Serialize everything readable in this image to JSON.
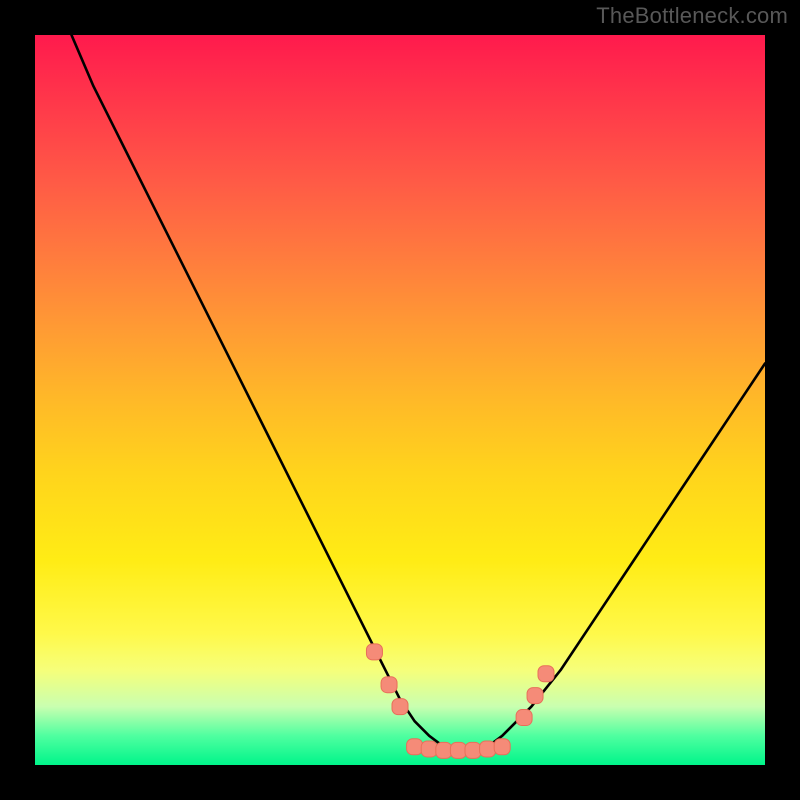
{
  "watermark": "TheBottleneck.com",
  "colors": {
    "frame": "#000000",
    "curve": "#000000",
    "marker_fill": "#f58b78",
    "marker_stroke": "#e86f5a"
  },
  "chart_data": {
    "type": "line",
    "title": "",
    "xlabel": "",
    "ylabel": "",
    "xlim": [
      0,
      100
    ],
    "ylim": [
      0,
      100
    ],
    "legend": false,
    "grid": false,
    "series": [
      {
        "name": "bottleneck-curve",
        "x": [
          5,
          8,
          12,
          16,
          20,
          24,
          28,
          32,
          36,
          40,
          44,
          48,
          50,
          52,
          54,
          56,
          58,
          60,
          62,
          64,
          68,
          72,
          76,
          80,
          84,
          88,
          92,
          96,
          100
        ],
        "y": [
          100,
          93,
          85,
          77,
          69,
          61,
          53,
          45,
          37,
          29,
          21,
          13,
          9,
          6,
          4,
          2.5,
          2,
          2,
          2.5,
          4,
          8,
          13,
          19,
          25,
          31,
          37,
          43,
          49,
          55
        ]
      }
    ],
    "markers": [
      {
        "name": "left-cluster-top",
        "x": 46.5,
        "y": 15.5
      },
      {
        "name": "left-cluster-mid",
        "x": 48.5,
        "y": 11
      },
      {
        "name": "left-cluster-low",
        "x": 50.0,
        "y": 8
      },
      {
        "name": "floor-1",
        "x": 52.0,
        "y": 2.5
      },
      {
        "name": "floor-2",
        "x": 54.0,
        "y": 2.2
      },
      {
        "name": "floor-3",
        "x": 56.0,
        "y": 2.0
      },
      {
        "name": "floor-4",
        "x": 58.0,
        "y": 2.0
      },
      {
        "name": "floor-5",
        "x": 60.0,
        "y": 2.0
      },
      {
        "name": "floor-6",
        "x": 62.0,
        "y": 2.2
      },
      {
        "name": "floor-7",
        "x": 64.0,
        "y": 2.5
      },
      {
        "name": "right-cluster-low",
        "x": 67.0,
        "y": 6.5
      },
      {
        "name": "right-cluster-mid",
        "x": 68.5,
        "y": 9.5
      },
      {
        "name": "right-cluster-top",
        "x": 70.0,
        "y": 12.5
      }
    ]
  }
}
